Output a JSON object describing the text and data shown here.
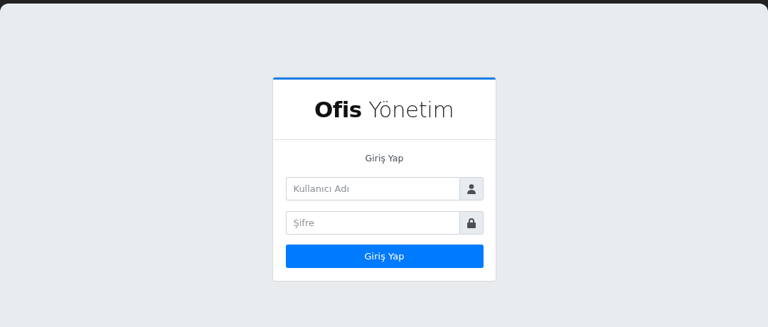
{
  "logo": "**Ofis** Yönetim",
  "login_box": {
    "message": "Giriş Yap",
    "fields": [
      {
        "kind": "username",
        "placeholder": "Kullanıcı Adı"
      },
      {
        "kind": "password",
        "placeholder": "Şifre"
      }
    ],
    "submit_button": "Giriş Yap"
  }
}
